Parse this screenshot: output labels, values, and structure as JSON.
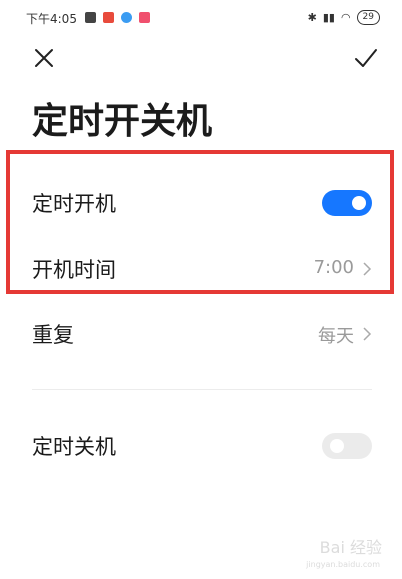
{
  "status_bar": {
    "time": "下午4:05",
    "battery": "29"
  },
  "page": {
    "title": "定时开关机"
  },
  "settings": {
    "power_on_label": "定时开机",
    "power_on_enabled": true,
    "power_on_time_label": "开机时间",
    "power_on_time_value": "7:00",
    "repeat_label": "重复",
    "repeat_value": "每天",
    "power_off_label": "定时关机",
    "power_off_enabled": false
  },
  "watermark": {
    "main": "Bai 经验",
    "sub": "jingyan.baidu.com"
  },
  "colors": {
    "accent": "#1677ff",
    "highlight": "#e53935",
    "toggle_off": "#ebebeb",
    "secondary_text": "#9a9a9a"
  },
  "icons": {
    "close": "close-icon",
    "confirm": "check-icon",
    "chevron": "chevron-right-icon"
  }
}
